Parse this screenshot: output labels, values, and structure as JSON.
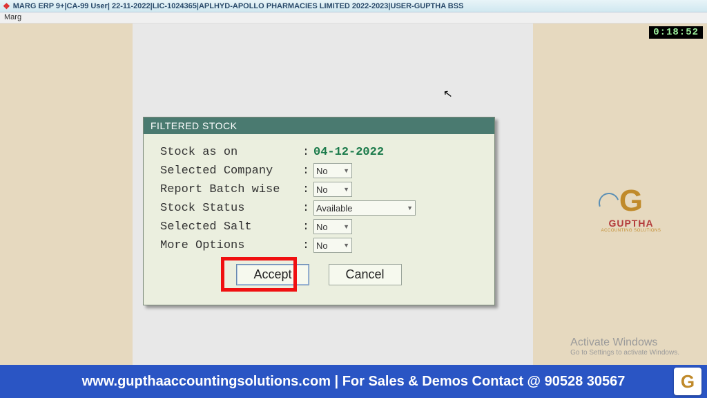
{
  "titlebar": {
    "text": "MARG ERP 9+|CA-99 User| 22-11-2022|LIC-1024365|APLHYD-APOLLO PHARMACIES LIMITED 2022-2023|USER-GUPTHA BSS"
  },
  "menubar": {
    "item": "Marg"
  },
  "clock": "0:18:52",
  "logo": {
    "name": "GUPTHA",
    "sub": "ACCOUNTING SOLUTIONS"
  },
  "dialog": {
    "title": "FILTERED STOCK",
    "fields": {
      "stock_as_on": {
        "label": "Stock as on",
        "value": "04-12-2022",
        "type": "date"
      },
      "selected_company": {
        "label": "Selected Company",
        "value": "No",
        "type": "select-sm"
      },
      "report_batch_wise": {
        "label": "Report Batch wise",
        "value": "No",
        "type": "select-sm"
      },
      "stock_status": {
        "label": "Stock Status",
        "value": "Available",
        "type": "select-lg"
      },
      "selected_salt": {
        "label": "Selected Salt",
        "value": "No",
        "type": "select-sm"
      },
      "more_options": {
        "label": "More Options",
        "value": "No",
        "type": "select-sm"
      }
    },
    "buttons": {
      "accept": "Accept",
      "cancel": "Cancel"
    }
  },
  "watermark": {
    "line1": "Activate Windows",
    "line2": "Go to Settings to activate Windows."
  },
  "banner": "www.gupthaaccountingsolutions.com | For Sales & Demos Contact @ 90528 30567"
}
